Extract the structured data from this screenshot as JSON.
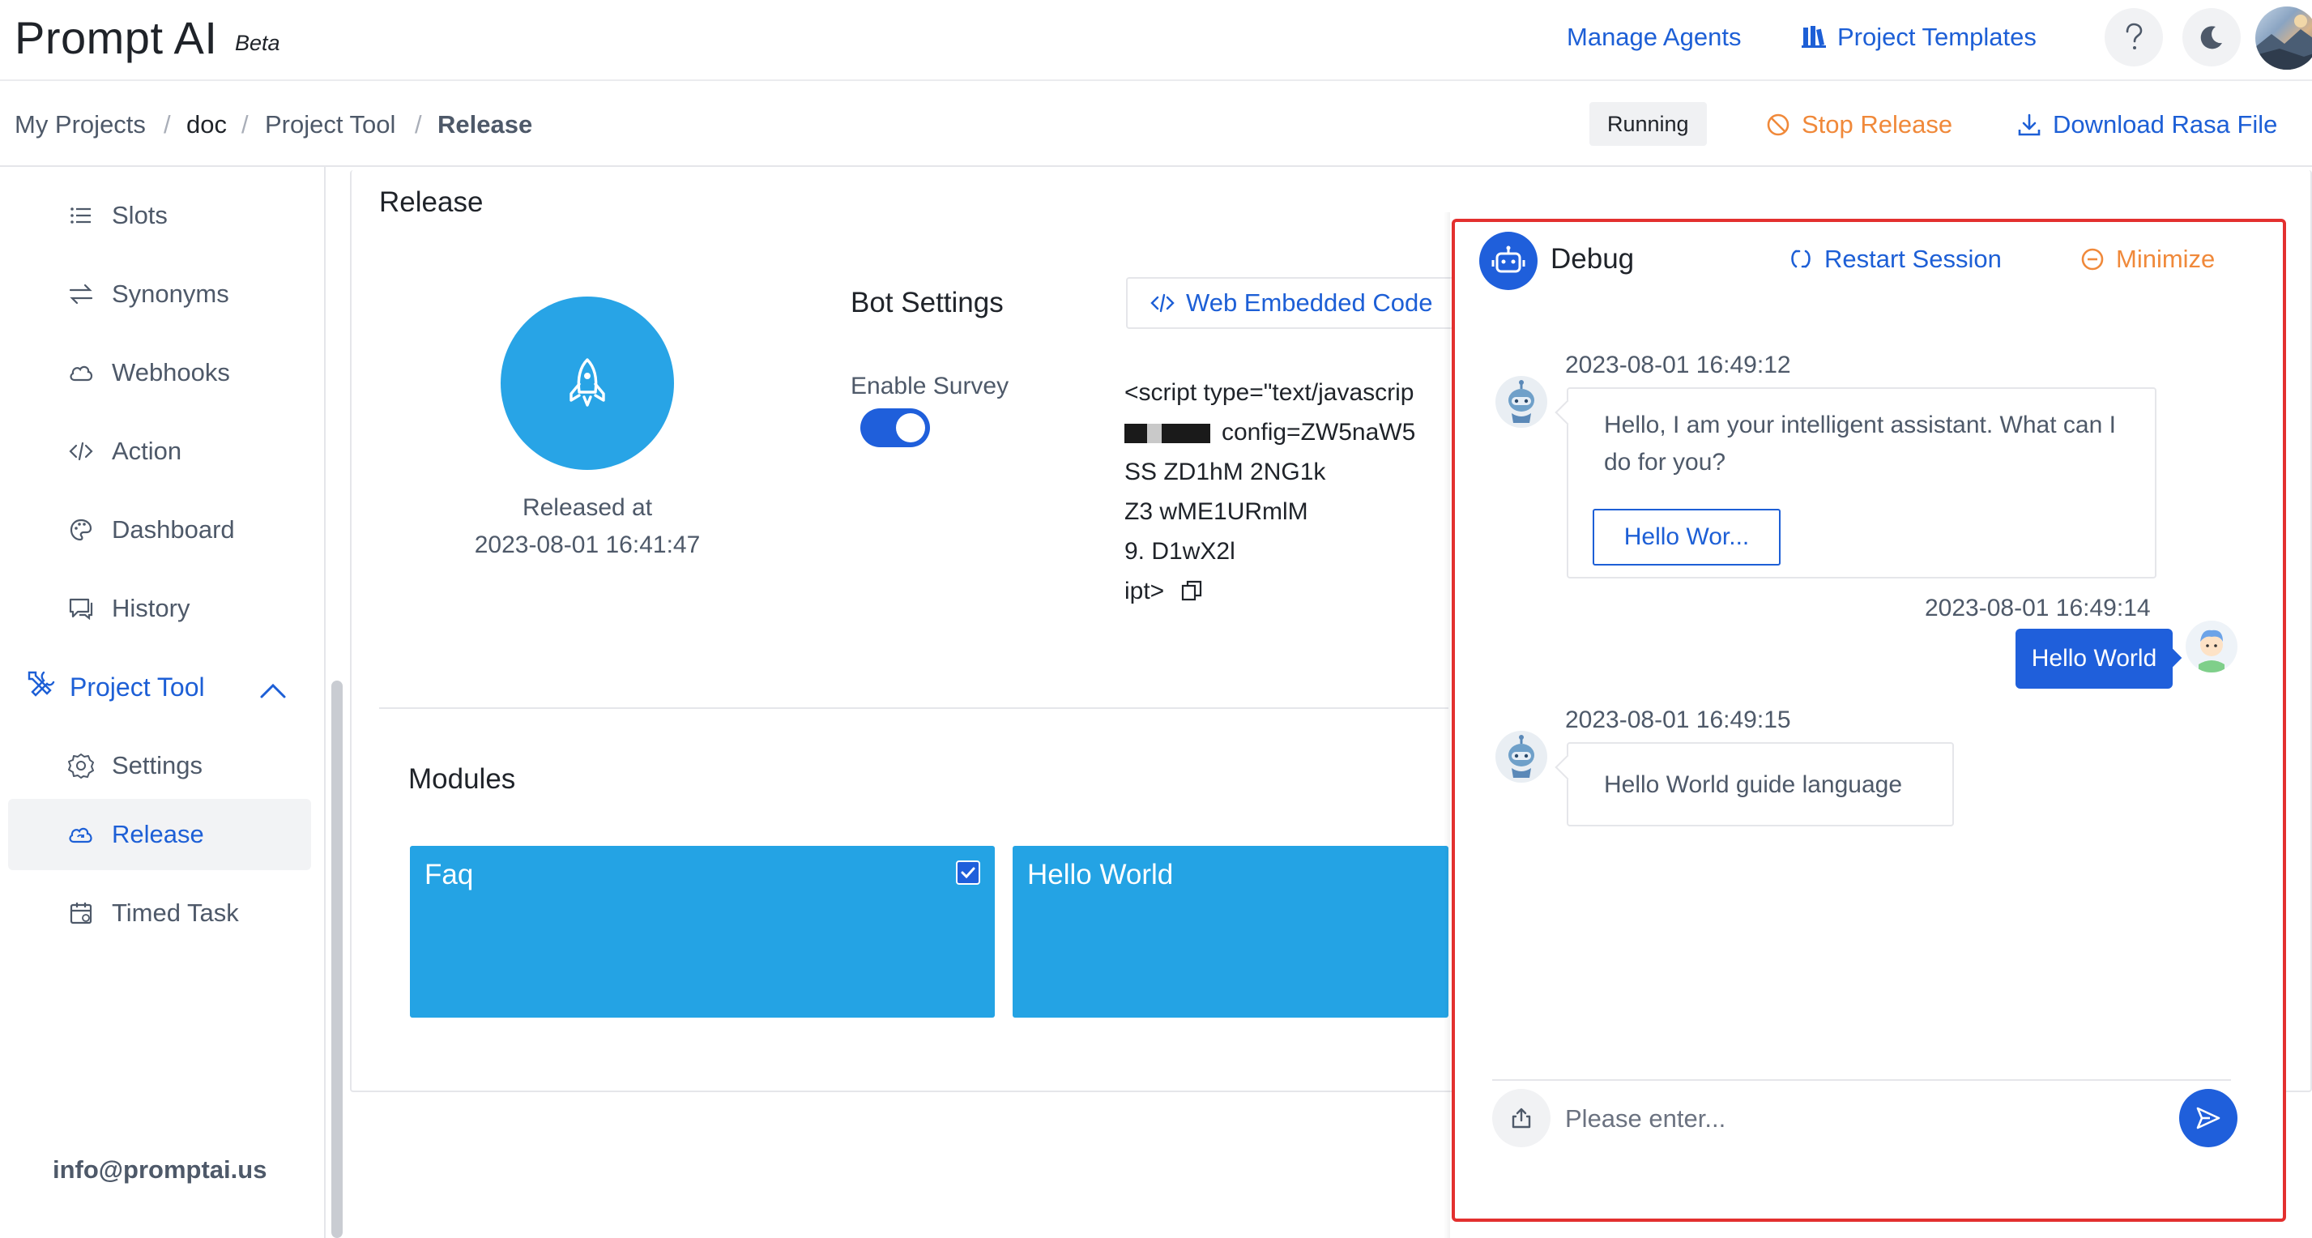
{
  "app": {
    "name": "Prompt AI",
    "badge": "Beta"
  },
  "header": {
    "links": [
      {
        "label": "Manage Agents"
      },
      {
        "label": "Project Templates",
        "icon": "books-icon"
      }
    ],
    "help_icon": "question-icon",
    "theme_icon": "moon-icon"
  },
  "breadcrumb": [
    "My Projects",
    "doc",
    "Project Tool",
    "Release"
  ],
  "breadcrumb_separator": "/",
  "toolbar": {
    "status": "Running",
    "stop_label": "Stop Release",
    "download_label": "Download Rasa File"
  },
  "sidebar": {
    "items": [
      {
        "label": "Slots",
        "icon": "list-icon"
      },
      {
        "label": "Synonyms",
        "icon": "swap-icon"
      },
      {
        "label": "Webhooks",
        "icon": "cloud-icon"
      },
      {
        "label": "Action",
        "icon": "code-icon"
      },
      {
        "label": "Dashboard",
        "icon": "palette-icon"
      },
      {
        "label": "History",
        "icon": "chat-history-icon"
      }
    ],
    "group": {
      "label": "Project Tool",
      "icon": "tools-icon"
    },
    "sub_items": [
      {
        "label": "Settings",
        "icon": "gear-icon"
      },
      {
        "label": "Release",
        "icon": "cloud-sync-icon",
        "active": true
      },
      {
        "label": "Timed Task",
        "icon": "calendar-icon"
      }
    ],
    "email": "info@promptai.us"
  },
  "release": {
    "title": "Release",
    "released_at_label": "Released at",
    "released_at": "2023-08-01 16:41:47",
    "bot_settings_title": "Bot Settings",
    "enable_survey_label": "Enable Survey",
    "enable_survey": true,
    "embed_button": "Web Embedded Code",
    "code_lines": [
      "<script type=\"text/javascrip",
      "config=ZW5naW5",
      "SS ZD1hM  2NG1k",
      "Z3  wME1URmlM",
      "9.  D1wX2l",
      "ipt>"
    ],
    "modules_title": "Modules",
    "modules": [
      {
        "name": "Faq",
        "checked": true
      },
      {
        "name": "Hello World",
        "checked": false
      }
    ]
  },
  "debug": {
    "title": "Debug",
    "restart_label": "Restart Session",
    "minimize_label": "Minimize",
    "messages": [
      {
        "from": "bot",
        "time": "2023-08-01 16:49:12",
        "text": "Hello, I am your intelligent assistant. What can I do for you?",
        "button": "Hello Wor..."
      },
      {
        "from": "user",
        "time": "2023-08-01 16:49:14",
        "text": "Hello World"
      },
      {
        "from": "bot",
        "time": "2023-08-01 16:49:15",
        "text": "Hello World guide language"
      }
    ],
    "input_placeholder": "Please enter..."
  },
  "colors": {
    "primary": "#1f5fdb",
    "link": "#1d5fd6",
    "warning": "#f0893a",
    "module": "#24a3e4",
    "highlight_border": "#e3302f"
  }
}
